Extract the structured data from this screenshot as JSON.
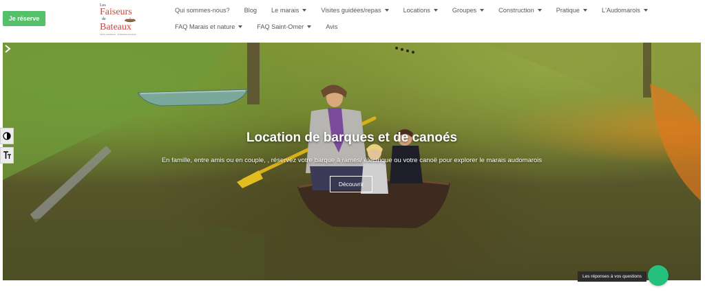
{
  "header": {
    "cta_label": "Je réserve",
    "logo": {
      "line1": "Les",
      "line2": "Faiseurs",
      "line3": "de",
      "line4": "Bateaux",
      "tagline": "Marais audomarois · Promenades en barque"
    },
    "nav_row1": [
      {
        "label": "Qui sommes-nous?",
        "dropdown": false
      },
      {
        "label": "Blog",
        "dropdown": false
      },
      {
        "label": "Le marais",
        "dropdown": true
      },
      {
        "label": "Visites guidées/repas",
        "dropdown": true
      },
      {
        "label": "Locations",
        "dropdown": true
      },
      {
        "label": "Groupes",
        "dropdown": true
      },
      {
        "label": "Construction",
        "dropdown": true
      },
      {
        "label": "Pratique",
        "dropdown": true
      },
      {
        "label": "L'Audomarois",
        "dropdown": true
      }
    ],
    "nav_row2": [
      {
        "label": "FAQ Marais et nature",
        "dropdown": true
      },
      {
        "label": "FAQ Saint-Omer",
        "dropdown": true
      },
      {
        "label": "Avis",
        "dropdown": false
      }
    ]
  },
  "hero": {
    "title": "Location de barques et de canoés",
    "subtitle": "En famille, entre amis ou en couple, , réservez votre barque à rames/ électrique ou votre canoë pour explorer le marais audomarois",
    "button_label": "Découvrir",
    "next_icon": "chevron-right-icon"
  },
  "accessibility": {
    "contrast_icon": "contrast-icon",
    "text_size_icon": "text-size-icon"
  },
  "chat": {
    "label": "Les réponses à vos questions",
    "icon": "chat-bubble-icon"
  },
  "colors": {
    "cta": "#54c06a",
    "chat": "#25c07e",
    "logo": "#c8463b",
    "nav_text": "#55595c"
  }
}
